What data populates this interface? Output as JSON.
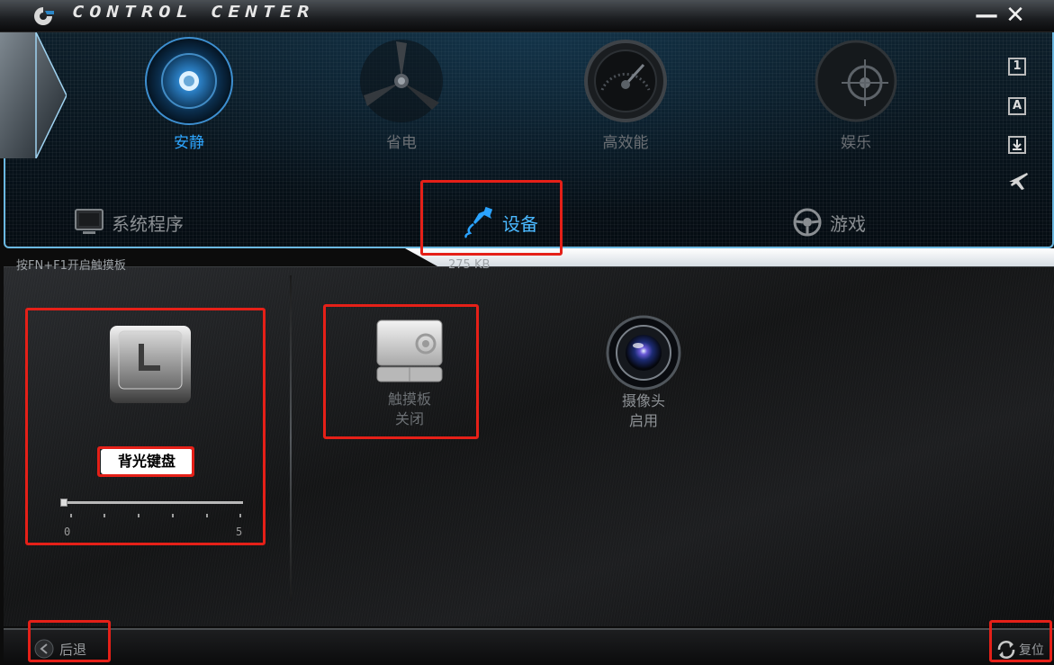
{
  "window": {
    "title": "CONTROL CENTER",
    "minimize": "—",
    "close": "✕"
  },
  "modes": [
    {
      "label": "安静",
      "icon": "speaker-icon",
      "active": true
    },
    {
      "label": "省电",
      "icon": "fan-icon",
      "active": false
    },
    {
      "label": "高效能",
      "icon": "speedometer-icon",
      "active": false
    },
    {
      "label": "娱乐",
      "icon": "crosshair-icon",
      "active": false
    }
  ],
  "side_icons": [
    "1",
    "A",
    "download-icon",
    "airplane-icon"
  ],
  "categories": [
    {
      "label": "系统程序",
      "icon": "monitor-icon",
      "active": false
    },
    {
      "label": "设备",
      "icon": "usb-plug-icon",
      "active": true
    },
    {
      "label": "游戏",
      "icon": "steering-wheel-icon",
      "active": false
    }
  ],
  "hint": "按FN+F1开启触摸板",
  "size_text": "275 KB",
  "keyboard": {
    "label": "背光键盘",
    "slider_value": 0,
    "slider_min": "0",
    "slider_max": "5"
  },
  "devices": [
    {
      "name": "触摸板",
      "state": "关闭",
      "icon": "touchpad-icon"
    },
    {
      "name": "摄像头",
      "state": "启用",
      "icon": "camera-icon"
    }
  ],
  "bottom": {
    "back": "后退",
    "reset": "复位"
  },
  "colors": {
    "accent": "#2ea6ff",
    "highlight": "#e52018",
    "panel_border": "#6ab7e0"
  }
}
